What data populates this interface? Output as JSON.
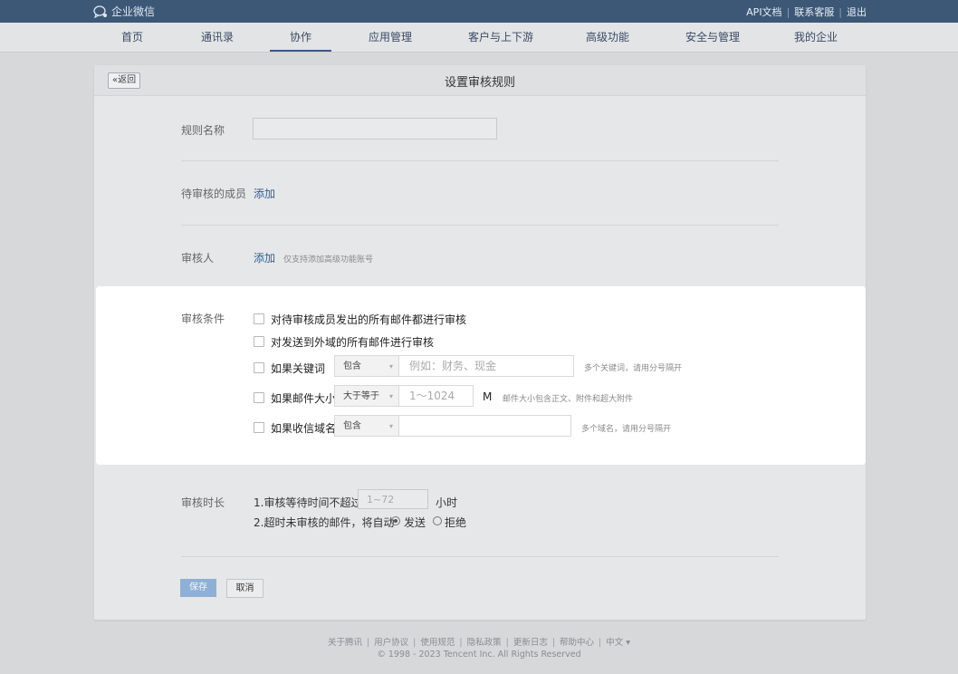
{
  "topbar": {
    "logo_text": "企业微信",
    "links": [
      "API文档",
      "联系客服",
      "退出"
    ]
  },
  "nav": {
    "items": [
      "首页",
      "通讯录",
      "协作",
      "应用管理",
      "客户与上下游",
      "高级功能",
      "安全与管理",
      "我的企业"
    ],
    "active": "协作"
  },
  "panel": {
    "back_label": "«返回",
    "title": "设置审核规则"
  },
  "form": {
    "rule_name_label": "规则名称",
    "rule_name_value": "",
    "members_label": "待审核的成员",
    "members_add": "添加",
    "reviewer_label": "审核人",
    "reviewer_add": "添加",
    "reviewer_hint": "仅支持添加高级功能账号"
  },
  "conditions": {
    "label": "审核条件",
    "all_mail": "对待审核成员发出的所有邮件都进行审核",
    "external": "对发送到外域的所有邮件进行审核",
    "keyword": {
      "label": "如果关键词",
      "select": "包含",
      "placeholder": "例如：财务、现金",
      "hint": "多个关键词，请用分号隔开"
    },
    "size": {
      "label": "如果邮件大小",
      "select": "大于等于",
      "placeholder": "1～1024",
      "unit": "M",
      "hint": "邮件大小包含正文、附件和超大附件"
    },
    "domain": {
      "label": "如果收信域名",
      "select": "包含",
      "value": "",
      "hint": "多个域名，请用分号隔开"
    }
  },
  "duration": {
    "label": "审核时长",
    "line1_prefix": "1.审核等待时间不超过",
    "line1_placeholder": "1~72",
    "line1_unit": "小时",
    "line2_prefix": "2.超时未审核的邮件，将自动",
    "option_send": "发送",
    "option_reject": "拒绝",
    "selected": "发送"
  },
  "buttons": {
    "save": "保存",
    "cancel": "取消"
  },
  "footer": {
    "links": [
      "关于腾讯",
      "用户协议",
      "使用规范",
      "隐私政策",
      "更新日志",
      "帮助中心",
      "中文 ▾"
    ],
    "copyright": "© 1998 - 2023 Tencent Inc. All Rights Reserved"
  }
}
